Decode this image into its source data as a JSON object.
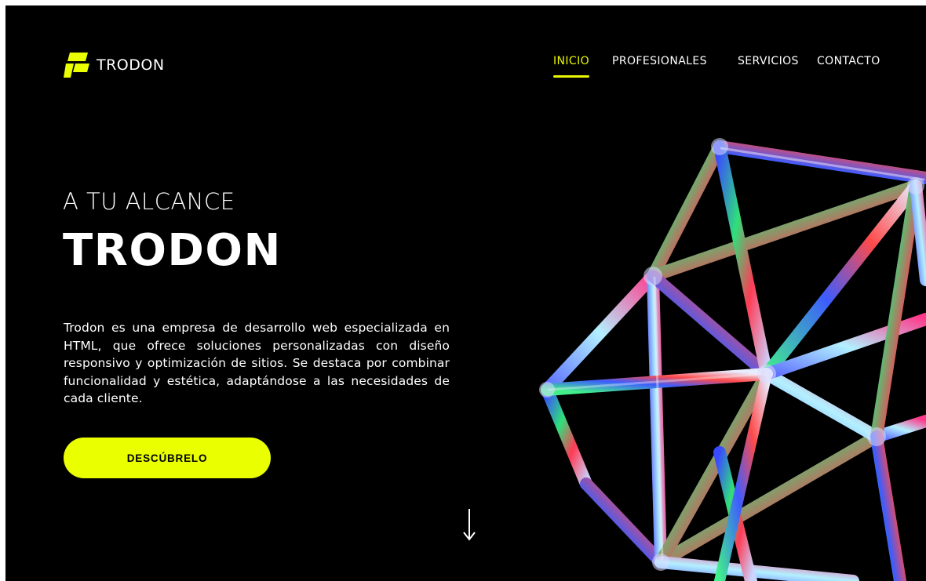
{
  "brand": {
    "name": "TRODON",
    "accent_color": "#eaff00",
    "logo_icon": "trodon-logo-icon"
  },
  "nav": {
    "items": [
      {
        "label": "INICIO",
        "active": true
      },
      {
        "label": "PROFESIONALES",
        "active": false
      },
      {
        "label": "SERVICIOS",
        "active": false
      },
      {
        "label": "CONTACTO",
        "active": false
      }
    ]
  },
  "hero": {
    "kicker": "A TU ALCANCE",
    "title": "TRODON",
    "description": "Trodon es una empresa de desarrollo web especializada en HTML, que ofrece soluciones personalizadas con diseño responsivo y optimización de sitios. Se destaca por combinar funcionalidad y estética, adaptándose a las necesidades de cada cliente.",
    "cta_label": "DESCÚBRELO",
    "scroll_icon": "arrow-down-icon",
    "artwork": "iridescent-icosahedron-wireframe"
  }
}
